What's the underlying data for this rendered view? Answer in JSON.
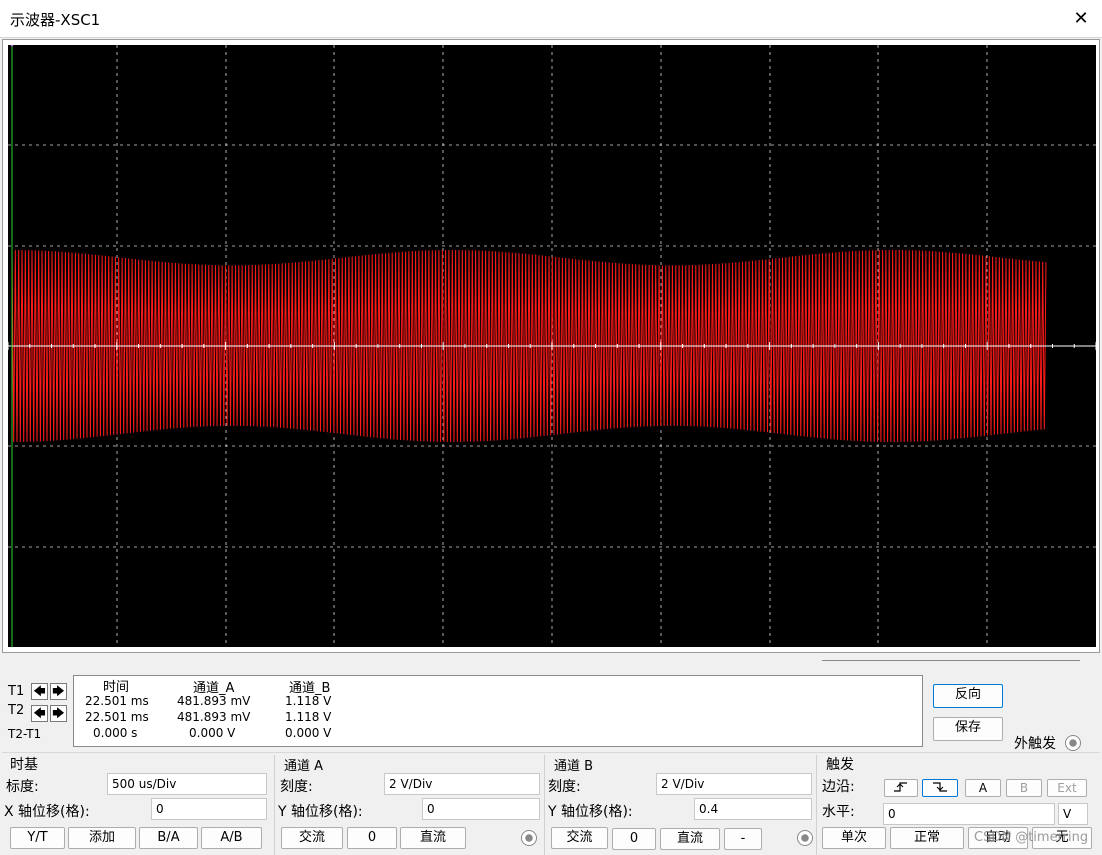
{
  "window": {
    "title": "示波器-XSC1"
  },
  "scope": {
    "colors": {
      "background": "#000000",
      "grid": "#d8d8d8",
      "trace_a": "#ff1a1a",
      "axis": "#ffffff"
    }
  },
  "cursors": {
    "t1_label": "T1",
    "t2_label": "T2",
    "diff_label": "T2-T1"
  },
  "readout": {
    "headers": [
      "时间",
      "通道_A",
      "通道_B"
    ],
    "rows": [
      [
        "22.501 ms",
        "481.893 mV",
        "1.118 V"
      ],
      [
        "22.501 ms",
        "481.893 mV",
        "1.118 V"
      ],
      [
        "0.000 s",
        "0.000 V",
        "0.000 V"
      ]
    ]
  },
  "side_buttons": {
    "reverse": "反向",
    "save": "保存",
    "ext_trigger_label": "外触发"
  },
  "timebase": {
    "title": "时基",
    "scale_label": "标度:",
    "scale_value": "500 us/Div",
    "xpos_label": "X 轴位移(格):",
    "xpos_value": "0",
    "buttons": [
      "Y/T",
      "添加",
      "B/A",
      "A/B"
    ]
  },
  "channel_a": {
    "title": "通道 A",
    "scale_label": "刻度:",
    "scale_value": "2  V/Div",
    "ypos_label": "Y 轴位移(格):",
    "ypos_value": "0",
    "buttons": [
      "交流",
      "0",
      "直流"
    ]
  },
  "channel_b": {
    "title": "通道 B",
    "scale_label": "刻度:",
    "scale_value": "2  V/Div",
    "ypos_label": "Y 轴位移(格):",
    "ypos_value": "0.4",
    "buttons": [
      "交流",
      "0",
      "直流",
      "-"
    ]
  },
  "trigger": {
    "title": "触发",
    "edge_label": "边沿:",
    "edge_buttons": [
      "A",
      "B",
      "Ext"
    ],
    "level_label": "水平:",
    "level_value": "0",
    "level_unit": "V",
    "mode_buttons": [
      "单次",
      "正常",
      "自动",
      "无"
    ]
  },
  "watermark": "CSDN @timerring"
}
